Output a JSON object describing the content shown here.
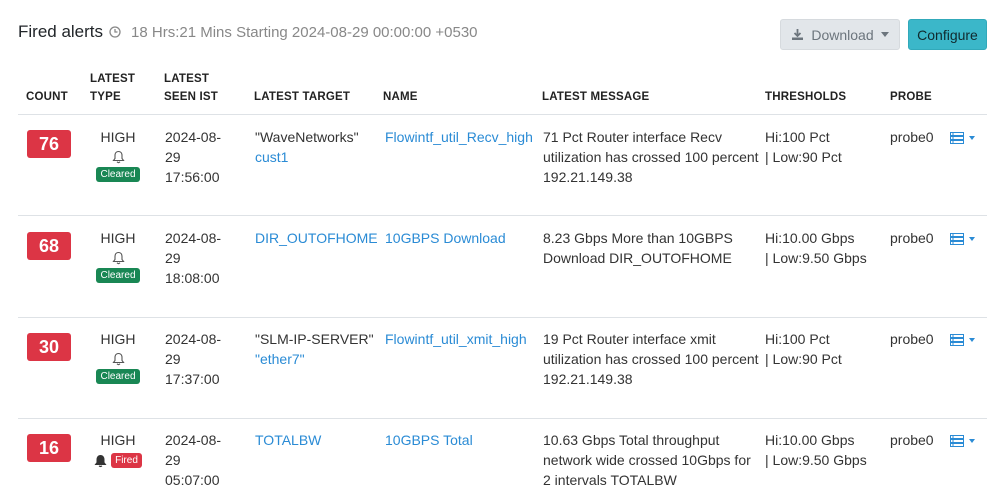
{
  "header": {
    "title": "Fired alerts",
    "subtitle": "18 Hrs:21 Mins Starting 2024-08-29 00:00:00 +0530",
    "download_label": "Download",
    "configure_label": "Configure"
  },
  "columns": {
    "count": "COUNT",
    "latest_type": [
      "LATEST",
      "TYPE"
    ],
    "latest_seen": [
      "LATEST",
      "SEEN IST"
    ],
    "latest_target": "LATEST TARGET",
    "name": "NAME",
    "latest_message": "LATEST MESSAGE",
    "thresholds": "THRESHOLDS",
    "probe": "PROBE"
  },
  "colors": {
    "count_badge": "#dc3545",
    "cleared": "#198754",
    "fired": "#dc3545",
    "link": "#2a8bd5",
    "configure": "#3bb7c9"
  },
  "rows": [
    {
      "count": "76",
      "type": "HIGH",
      "status": "Cleared",
      "seen": [
        "2024-08-",
        "29",
        "17:56:00"
      ],
      "target": [
        "\"WaveNetworks\"",
        "cust1"
      ],
      "name": "Flowintf_util_Recv_high",
      "message": [
        "71 Pct Router interface Recv",
        "utilization has crossed 100 percent",
        "192.21.149.38"
      ],
      "thresholds": [
        "Hi:100 Pct",
        "| Low:90 Pct"
      ],
      "probe": "probe0"
    },
    {
      "count": "68",
      "type": "HIGH",
      "status": "Cleared",
      "seen": [
        "2024-08-",
        "29",
        "18:08:00"
      ],
      "target": [
        "DIR_OUTOFHOME"
      ],
      "name": "10GBPS Download",
      "message": [
        "8.23 Gbps More than 10GBPS",
        "Download DIR_OUTOFHOME"
      ],
      "thresholds": [
        "Hi:10.00 Gbps",
        "| Low:9.50 Gbps"
      ],
      "probe": "probe0"
    },
    {
      "count": "30",
      "type": "HIGH",
      "status": "Cleared",
      "seen": [
        "2024-08-",
        "29",
        "17:37:00"
      ],
      "target": [
        "\"SLM-IP-SERVER\"",
        "\"ether7\""
      ],
      "name": "Flowintf_util_xmit_high",
      "message": [
        "19 Pct Router interface xmit",
        "utilization has crossed 100 percent",
        "192.21.149.38"
      ],
      "thresholds": [
        "Hi:100 Pct",
        "| Low:90 Pct"
      ],
      "probe": "probe0"
    },
    {
      "count": "16",
      "type": "HIGH",
      "status": "Fired",
      "seen": [
        "2024-08-",
        "29",
        "05:07:00"
      ],
      "target": [
        "TOTALBW"
      ],
      "name": "10GBPS Total",
      "message": [
        "10.63 Gbps Total throughput",
        "network wide crossed 10Gbps for",
        "2 intervals TOTALBW"
      ],
      "thresholds": [
        "Hi:10.00 Gbps",
        "| Low:9.50 Gbps"
      ],
      "probe": "probe0"
    }
  ]
}
